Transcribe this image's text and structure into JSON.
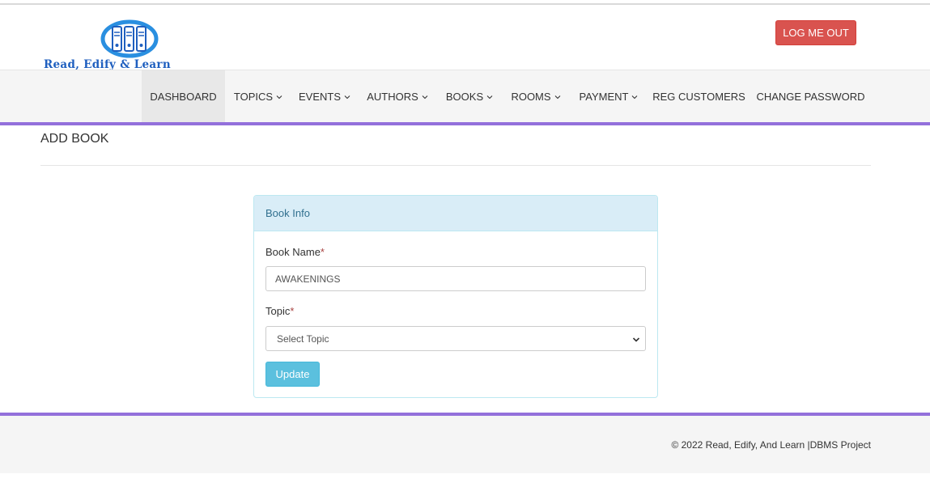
{
  "logo": {
    "text": "Read, Edify & Learn",
    "icon": "books-circle-logo"
  },
  "header": {
    "logout_label": "LOG ME OUT"
  },
  "nav": {
    "items": [
      {
        "label": "DASHBOARD",
        "dropdown": false,
        "active": true
      },
      {
        "label": "TOPICS",
        "dropdown": true
      },
      {
        "label": "EVENTS",
        "dropdown": true
      },
      {
        "label": "AUTHORS",
        "dropdown": true
      },
      {
        "label": "BOOKS",
        "dropdown": true
      },
      {
        "label": "ROOMS",
        "dropdown": true
      },
      {
        "label": "PAYMENT",
        "dropdown": true
      },
      {
        "label": "REG CUSTOMERS",
        "dropdown": false
      },
      {
        "label": "CHANGE PASSWORD",
        "dropdown": false
      }
    ]
  },
  "page": {
    "title": "ADD BOOK"
  },
  "form": {
    "panel_title": "Book Info",
    "book_name_label": "Book Name",
    "book_name_value": "AWAKENINGS",
    "topic_label": "Topic",
    "topic_selected": "Select Topic",
    "required_mark": "*",
    "submit_label": "Update"
  },
  "footer": {
    "text": "© 2022 Read, Edify, And Learn |DBMS Project"
  },
  "colors": {
    "accent_purple": "#9370db",
    "danger": "#d9534f",
    "info": "#5bc0de",
    "panel_heading_bg": "#d9edf7",
    "panel_heading_text": "#31708f"
  }
}
